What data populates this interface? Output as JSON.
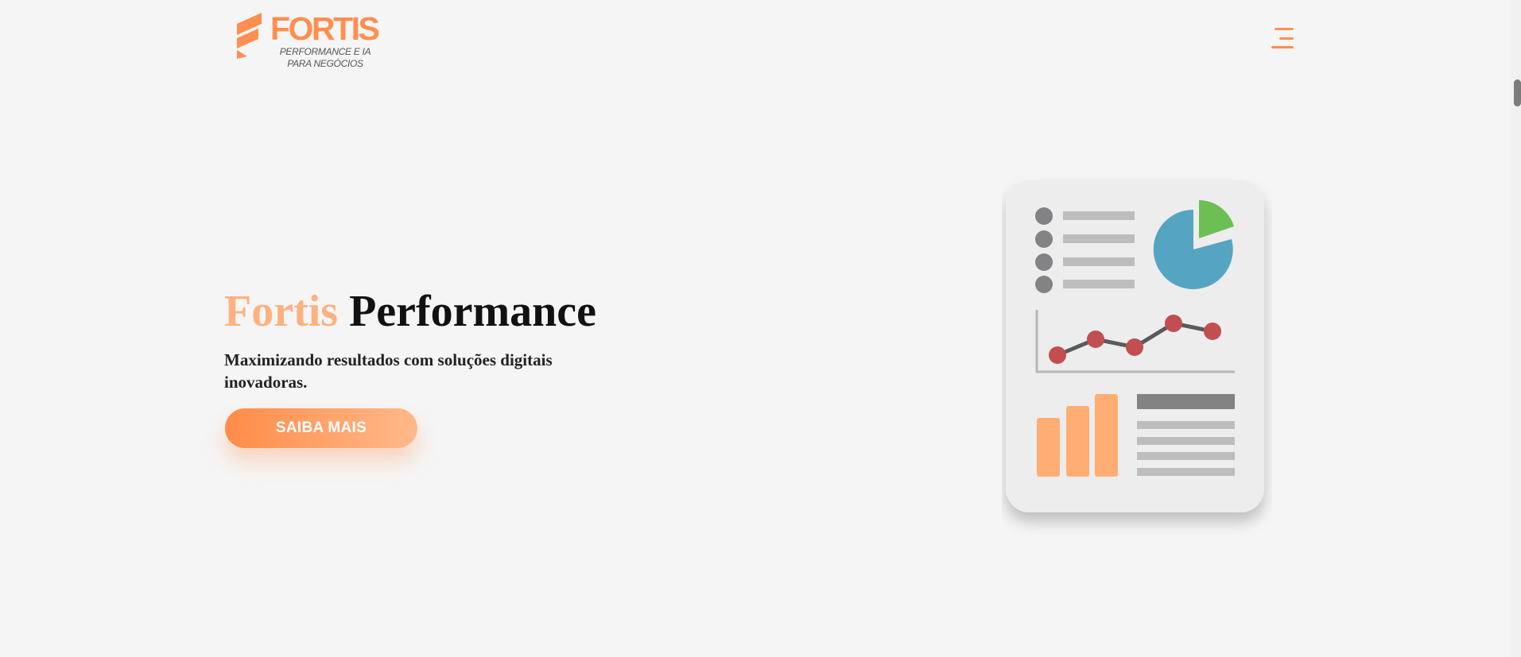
{
  "brand": {
    "name": "FORTIS",
    "tagline_line1": "PERFORMANCE E IA",
    "tagline_line2": "PARA NEGÓCIOS",
    "accent_color": "#ff8f50"
  },
  "header": {
    "menu_icon": "hamburger-menu-icon"
  },
  "hero": {
    "title_accent": "Fortis",
    "title_rest": " Performance",
    "subtitle": "Maximizando resultados com soluções digitais inovadoras.",
    "cta_label": "SAIBA MAIS"
  },
  "illustration": {
    "icon": "dashboard-report-illustration",
    "colors": {
      "card": "#ededed",
      "pie_main": "#55a5c2",
      "pie_slice": "#6cbf52",
      "line_points": "#c14e51",
      "bars": "#ffad73",
      "text_lines": "#bdbdbd",
      "bullets": "#838385"
    }
  }
}
